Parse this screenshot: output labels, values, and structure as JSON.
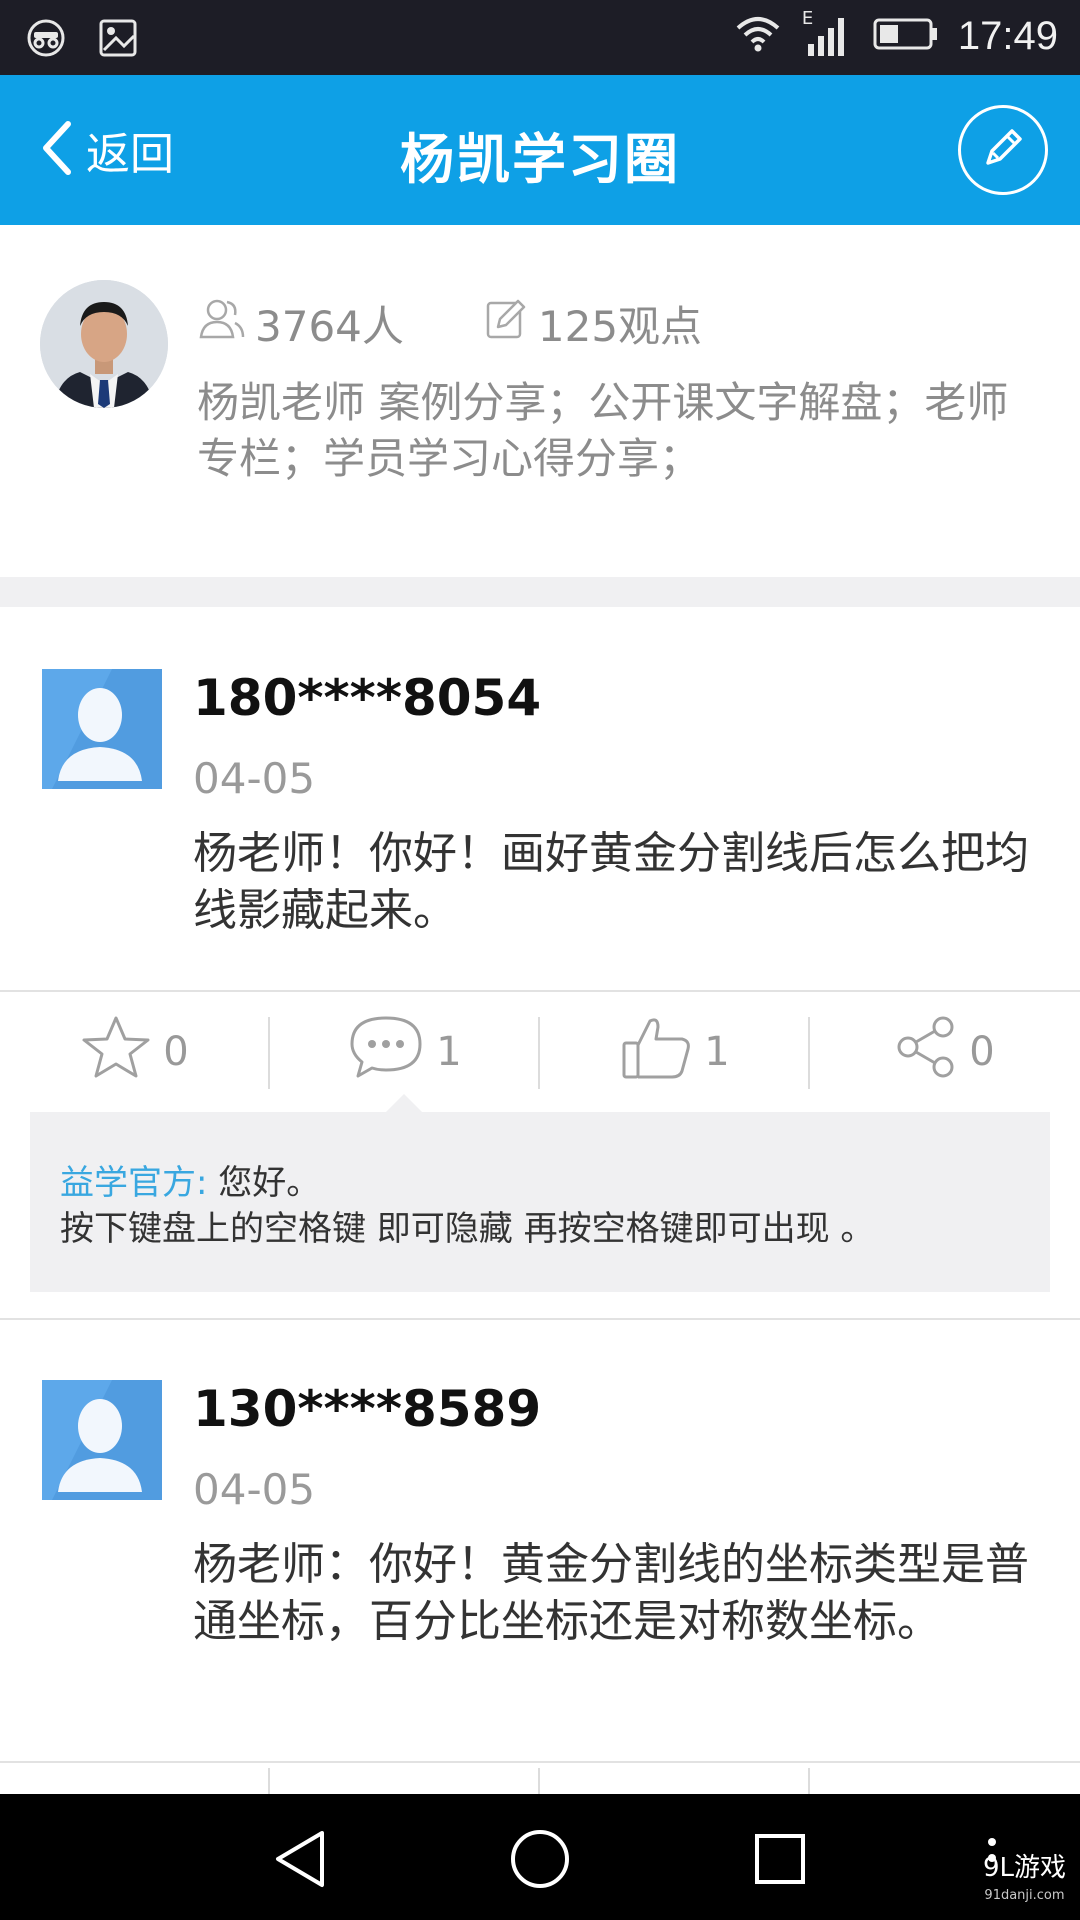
{
  "status_bar": {
    "time": "17:49",
    "network_label": "E"
  },
  "header": {
    "back_label": "返回",
    "title": "杨凯学习圈"
  },
  "profile": {
    "members": "3764人",
    "viewpoints": "125观点",
    "description": "杨凯老师 案例分享；公开课文字解盘；老师专栏；学员学习心得分享；"
  },
  "posts": [
    {
      "user": "180****8054",
      "date": "04-05",
      "text": "杨老师！你好！画好黄金分割线后怎么把均线影藏起来。",
      "favorites": "0",
      "comments": "1",
      "likes": "1",
      "shares": "0",
      "replies": [
        {
          "author": "益学官方:",
          "text": "您好。",
          "text2": "按下键盘上的空格键 即可隐藏 再按空格键即可出现 。"
        }
      ]
    },
    {
      "user": "130****8589",
      "date": "04-05",
      "text": "杨老师：你好！黄金分割线的坐标类型是普通坐标，百分比坐标还是对称数坐标。"
    }
  ],
  "watermark": {
    "brand": "9L游戏",
    "site": "91danji.com"
  },
  "colors": {
    "header": "#0ea0e6",
    "accent": "#39a7e0",
    "status_bar": "#1d1d26"
  }
}
